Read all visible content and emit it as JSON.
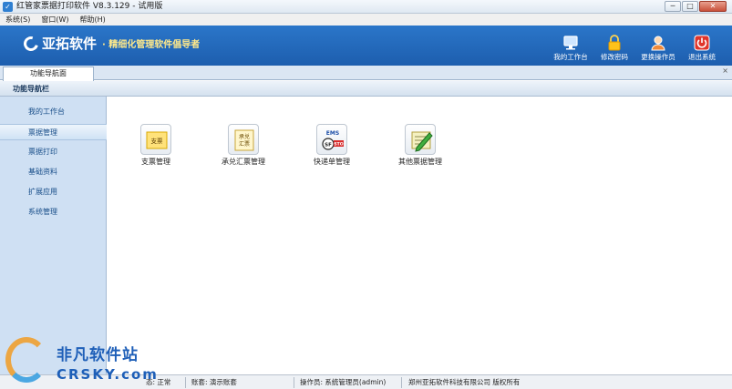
{
  "window": {
    "title": "红管家票据打印软件 V8.3.129 - 试用版",
    "min": "─",
    "max": "□",
    "close": "✕"
  },
  "menu": [
    "系统(S)",
    "窗口(W)",
    "帮助(H)"
  ],
  "banner": {
    "brand": "亚拓软件",
    "slogan": "· 精细化管理软件倡导者",
    "buttons": [
      {
        "label": "我的工作台",
        "icon": "monitor-icon"
      },
      {
        "label": "修改密码",
        "icon": "lock-icon"
      },
      {
        "label": "更换操作员",
        "icon": "user-icon"
      },
      {
        "label": "退出系统",
        "icon": "power-icon"
      }
    ]
  },
  "tab": {
    "label": "功能导航面",
    "close": "×"
  },
  "navhead": "功能导航栏",
  "sidebar": {
    "items": [
      {
        "label": "我的工作台",
        "active": false
      },
      {
        "label": "票据管理",
        "active": true
      },
      {
        "label": "票据打印",
        "active": false
      },
      {
        "label": "基础资料",
        "active": false
      },
      {
        "label": "扩展应用",
        "active": false
      },
      {
        "label": "系统管理",
        "active": false
      }
    ]
  },
  "tiles": [
    {
      "label": "支票管理",
      "icon": "check-icon",
      "icon_text": "支票"
    },
    {
      "label": "承兑汇票管理",
      "icon": "draft-icon",
      "icon_text": "承兑\n汇票"
    },
    {
      "label": "快递单管理",
      "icon": "express-icon",
      "icon_text": "EMS"
    },
    {
      "label": "其他票据管理",
      "icon": "edit-icon",
      "icon_text": ""
    }
  ],
  "status": {
    "state": "态: 正常",
    "account": "账套: 演示账套",
    "operator": "操作员: 系统管理员(admin)",
    "company": "郑州亚拓软件科技有限公司  版权所有"
  },
  "watermark": {
    "line1": "非凡软件站",
    "line2": "CRSKY.com"
  }
}
